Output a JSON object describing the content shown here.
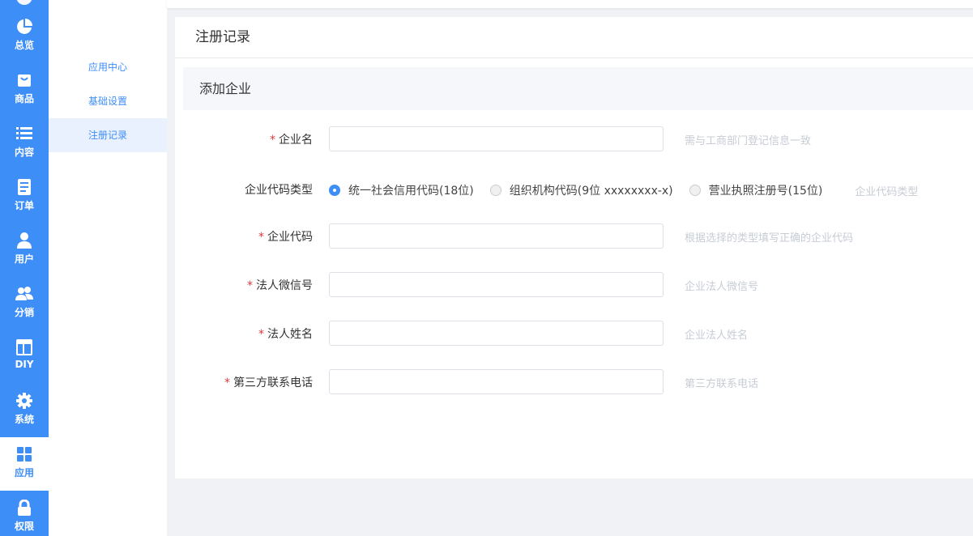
{
  "nav": {
    "items": [
      {
        "label": "总览",
        "icon": "pie-chart-icon"
      },
      {
        "label": "商品",
        "icon": "shopping-bag-icon"
      },
      {
        "label": "内容",
        "icon": "list-icon"
      },
      {
        "label": "订单",
        "icon": "document-icon"
      },
      {
        "label": "用户",
        "icon": "user-icon"
      },
      {
        "label": "分销",
        "icon": "users-icon"
      },
      {
        "label": "DIY",
        "icon": "layout-icon"
      },
      {
        "label": "系统",
        "icon": "gear-icon"
      },
      {
        "label": "应用",
        "icon": "apps-grid-icon",
        "active": true
      },
      {
        "label": "权限",
        "icon": "lock-icon"
      }
    ],
    "accent_color": "#3e8ef7"
  },
  "submenu": {
    "items": [
      {
        "label": "应用中心"
      },
      {
        "label": "基础设置"
      },
      {
        "label": "注册记录",
        "active": true
      }
    ]
  },
  "page": {
    "title": "注册记录",
    "section_title": "添加企业"
  },
  "form": {
    "company_name": {
      "label": "企业名",
      "hint": "需与工商部门登记信息一致",
      "value": ""
    },
    "code_type": {
      "label": "企业代码类型",
      "options": [
        {
          "label": "统一社会信用代码(18位)",
          "checked": true
        },
        {
          "label": "组织机构代码(9位 xxxxxxxx-x)",
          "checked": false
        },
        {
          "label": "营业执照注册号(15位)",
          "checked": false
        }
      ],
      "hint": "企业代码类型"
    },
    "company_code": {
      "label": "企业代码",
      "hint": "根据选择的类型填写正确的企业代码",
      "value": ""
    },
    "legal_wechat": {
      "label": "法人微信号",
      "hint": "企业法人微信号",
      "value": ""
    },
    "legal_name": {
      "label": "法人姓名",
      "hint": "企业法人姓名",
      "value": ""
    },
    "third_phone": {
      "label": "第三方联系电话",
      "hint": "第三方联系电话",
      "value": ""
    },
    "required_mark": "*"
  }
}
